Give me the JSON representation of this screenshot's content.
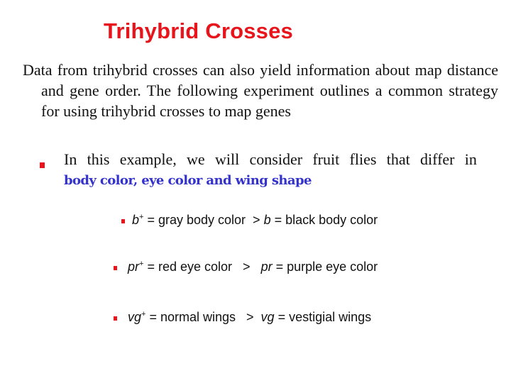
{
  "slide": {
    "title": "Trihybrid Crosses",
    "intro_paragraph": "Data from trihybrid crosses can also yield information about map distance and gene order. The following experiment outlines a common strategy for using trihybrid crosses to map genes",
    "bullet": {
      "icon": "red-square-bullet",
      "text_line1_words": [
        "In",
        "this",
        "example,",
        "we",
        "will",
        "consider",
        "fruit",
        "flies",
        "that",
        "differ",
        "in"
      ],
      "emphasis": "body color, eye color and wing shape",
      "colors": {
        "emphasis": "#3333cc",
        "bullet": "#e8141b"
      }
    },
    "traits": [
      {
        "dominant_allele": "b",
        "dominant_sup": "+",
        "dominant_desc": " = gray body color  ",
        "relation": ">",
        "recessive_allele": "b",
        "recessive_desc": " = black body color"
      },
      {
        "dominant_allele": "pr",
        "dominant_sup": "+",
        "dominant_desc": " = red eye color   ",
        "relation": ">",
        "recessive_allele": "pr",
        "recessive_desc": " = purple eye color"
      },
      {
        "dominant_allele": "vg",
        "dominant_sup": "+",
        "dominant_desc": " = normal wings   ",
        "relation": ">",
        "recessive_allele": "vg",
        "recessive_desc": " = vestigial wings"
      }
    ],
    "title_color": "#e8141b"
  }
}
